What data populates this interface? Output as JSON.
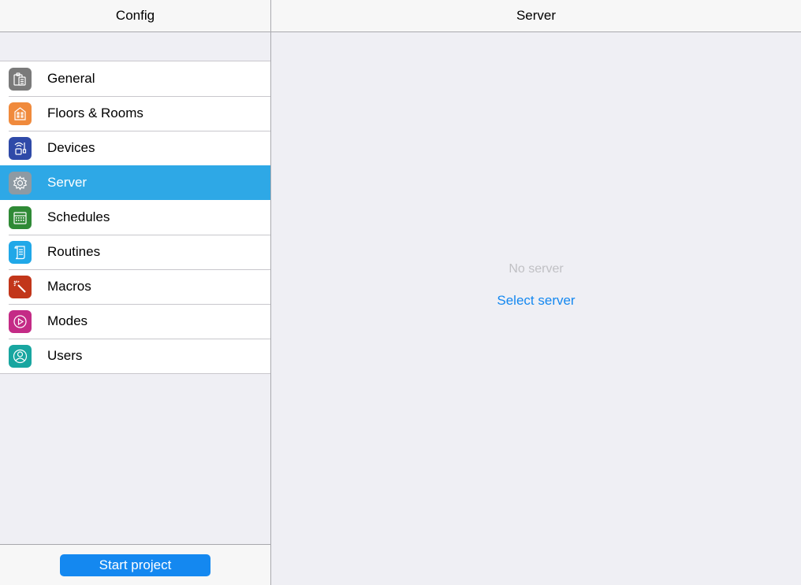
{
  "left_panel": {
    "title": "Config",
    "start_button_label": "Start project"
  },
  "menu": {
    "items": [
      {
        "label": "General",
        "icon": "clipboard-icon",
        "color": "#7a7a7a"
      },
      {
        "label": "Floors & Rooms",
        "icon": "building-icon",
        "color": "#f08a3c"
      },
      {
        "label": "Devices",
        "icon": "wireless-device-icon",
        "color": "#2f4aa8"
      },
      {
        "label": "Server",
        "icon": "gear-icon",
        "color": "#8e9aa3"
      },
      {
        "label": "Schedules",
        "icon": "calendar-icon",
        "color": "#2f8a36"
      },
      {
        "label": "Routines",
        "icon": "scroll-icon",
        "color": "#20a8e8"
      },
      {
        "label": "Macros",
        "icon": "magic-wand-icon",
        "color": "#c2361a"
      },
      {
        "label": "Modes",
        "icon": "play-icon",
        "color": "#c42b86"
      },
      {
        "label": "Users",
        "icon": "user-icon",
        "color": "#18a6a0"
      }
    ],
    "selected_index": 3,
    "selected_color": "#2ea8e6"
  },
  "right_panel": {
    "title": "Server",
    "empty_text": "No server",
    "select_link": "Select server"
  },
  "colors": {
    "accent": "#1488f0",
    "background": "#efeff4"
  }
}
